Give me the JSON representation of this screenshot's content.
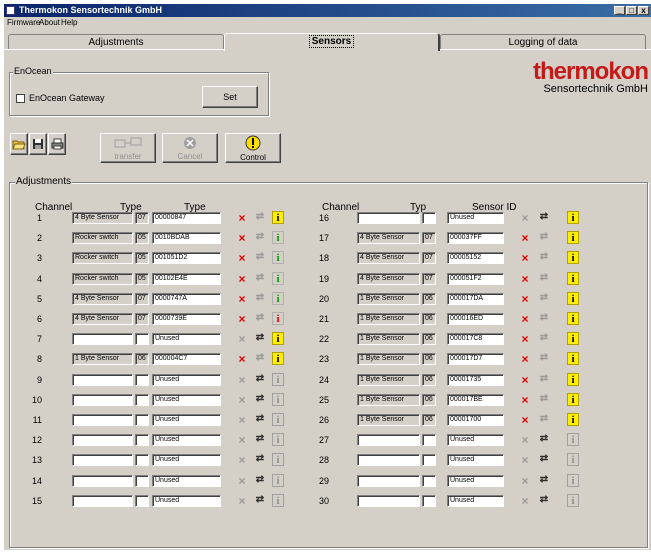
{
  "window": {
    "title": "Thermokon Sensortechnik GmbH",
    "controls": [
      "_",
      "□",
      "x"
    ]
  },
  "menu": [
    "Firmware",
    "About",
    "Help"
  ],
  "tabs": [
    {
      "label": "Adjustments"
    },
    {
      "label": "Sensors"
    },
    {
      "label": "Logging of data"
    }
  ],
  "enocean": {
    "group_label": "EnOcean",
    "gateway_checkbox_label": "EnOcean Gateway",
    "set_label": "Set"
  },
  "logo": {
    "line1": "thermokon",
    "line2": "Sensortechnik GmbH"
  },
  "toolbar": {
    "transfer_label": "transfer",
    "cancel_label": "Cancel",
    "control_label": "Control"
  },
  "adjustments": {
    "group_label": "Adjustments",
    "left_headers": [
      "Channel",
      "Type",
      "Type"
    ],
    "right_headers": [
      "Channel",
      "Typ",
      "Sensor ID"
    ]
  },
  "left_rows": [
    {
      "ch": "1",
      "type": "4 Byte Sensor",
      "code": "07",
      "id": "00000847",
      "x": "red",
      "link": "gray",
      "info": "yellow"
    },
    {
      "ch": "2",
      "type": "Rocker switch",
      "code": "05",
      "id": "0010BDAB",
      "x": "red",
      "link": "gray",
      "info": "green"
    },
    {
      "ch": "3",
      "type": "Rocker switch",
      "code": "05",
      "id": "001051D2",
      "x": "red",
      "link": "gray",
      "info": "green"
    },
    {
      "ch": "4",
      "type": "Rocker switch",
      "code": "05",
      "id": "00102E4E",
      "x": "red",
      "link": "gray",
      "info": "green"
    },
    {
      "ch": "5",
      "type": "4 Byte Sensor",
      "code": "07",
      "id": "0000747A",
      "x": "red",
      "link": "gray",
      "info": "green"
    },
    {
      "ch": "6",
      "type": "4 Byte Sensor",
      "code": "07",
      "id": "0000739E",
      "x": "red",
      "link": "gray",
      "info": "red"
    },
    {
      "ch": "7",
      "type": "",
      "code": "",
      "id": "Unused",
      "x": "gray",
      "link": "dark",
      "info": "yellow"
    },
    {
      "ch": "8",
      "type": "1 Byte Sensor",
      "code": "06",
      "id": "000004C7",
      "x": "red",
      "link": "gray",
      "info": "yellow"
    },
    {
      "ch": "9",
      "type": "",
      "code": "",
      "id": "Unused",
      "x": "gray",
      "link": "dark",
      "info": "gray"
    },
    {
      "ch": "10",
      "type": "",
      "code": "",
      "id": "Unused",
      "x": "gray",
      "link": "dark",
      "info": "gray"
    },
    {
      "ch": "11",
      "type": "",
      "code": "",
      "id": "Unused",
      "x": "gray",
      "link": "dark",
      "info": "gray"
    },
    {
      "ch": "12",
      "type": "",
      "code": "",
      "id": "Unused",
      "x": "gray",
      "link": "dark",
      "info": "gray"
    },
    {
      "ch": "13",
      "type": "",
      "code": "",
      "id": "Unused",
      "x": "gray",
      "link": "dark",
      "info": "gray"
    },
    {
      "ch": "14",
      "type": "",
      "code": "",
      "id": "Unused",
      "x": "gray",
      "link": "dark",
      "info": "gray"
    },
    {
      "ch": "15",
      "type": "",
      "code": "",
      "id": "Unused",
      "x": "gray",
      "link": "dark",
      "info": "gray"
    }
  ],
  "right_rows": [
    {
      "ch": "16",
      "type": "",
      "code": "",
      "id": "Unused",
      "x": "gray",
      "link": "dark",
      "info": "yellow"
    },
    {
      "ch": "17",
      "type": "4 Byte Sensor",
      "code": "07",
      "id": "000037FF",
      "x": "red",
      "link": "gray",
      "info": "yellow"
    },
    {
      "ch": "18",
      "type": "4 Byte Sensor",
      "code": "07",
      "id": "00005152",
      "x": "red",
      "link": "gray",
      "info": "yellow"
    },
    {
      "ch": "19",
      "type": "4 Byte Sensor",
      "code": "07",
      "id": "000051F2",
      "x": "red",
      "link": "gray",
      "info": "yellow"
    },
    {
      "ch": "20",
      "type": "1 Byte Sensor",
      "code": "06",
      "id": "000017DA",
      "x": "red",
      "link": "gray",
      "info": "yellow"
    },
    {
      "ch": "21",
      "type": "1 Byte Sensor",
      "code": "06",
      "id": "000016ED",
      "x": "red",
      "link": "gray",
      "info": "yellow"
    },
    {
      "ch": "22",
      "type": "1 Byte Sensor",
      "code": "06",
      "id": "000017C8",
      "x": "red",
      "link": "gray",
      "info": "yellow"
    },
    {
      "ch": "23",
      "type": "1 Byte Sensor",
      "code": "06",
      "id": "000017D7",
      "x": "red",
      "link": "gray",
      "info": "yellow"
    },
    {
      "ch": "24",
      "type": "1 Byte Sensor",
      "code": "06",
      "id": "00001735",
      "x": "red",
      "link": "gray",
      "info": "yellow"
    },
    {
      "ch": "25",
      "type": "1 Byte Sensor",
      "code": "06",
      "id": "000017BE",
      "x": "red",
      "link": "gray",
      "info": "yellow"
    },
    {
      "ch": "26",
      "type": "1 Byte Sensor",
      "code": "06",
      "id": "00001700",
      "x": "red",
      "link": "gray",
      "info": "yellow"
    },
    {
      "ch": "27",
      "type": "",
      "code": "",
      "id": "Unused",
      "x": "gray",
      "link": "dark",
      "info": "gray"
    },
    {
      "ch": "28",
      "type": "",
      "code": "",
      "id": "Unused",
      "x": "gray",
      "link": "dark",
      "info": "gray"
    },
    {
      "ch": "29",
      "type": "",
      "code": "",
      "id": "Unused",
      "x": "gray",
      "link": "dark",
      "info": "gray"
    },
    {
      "ch": "30",
      "type": "",
      "code": "",
      "id": "Unused",
      "x": "gray",
      "link": "dark",
      "info": "gray"
    }
  ],
  "icons": {
    "delete": "×",
    "link": "⇄",
    "info": "i"
  }
}
